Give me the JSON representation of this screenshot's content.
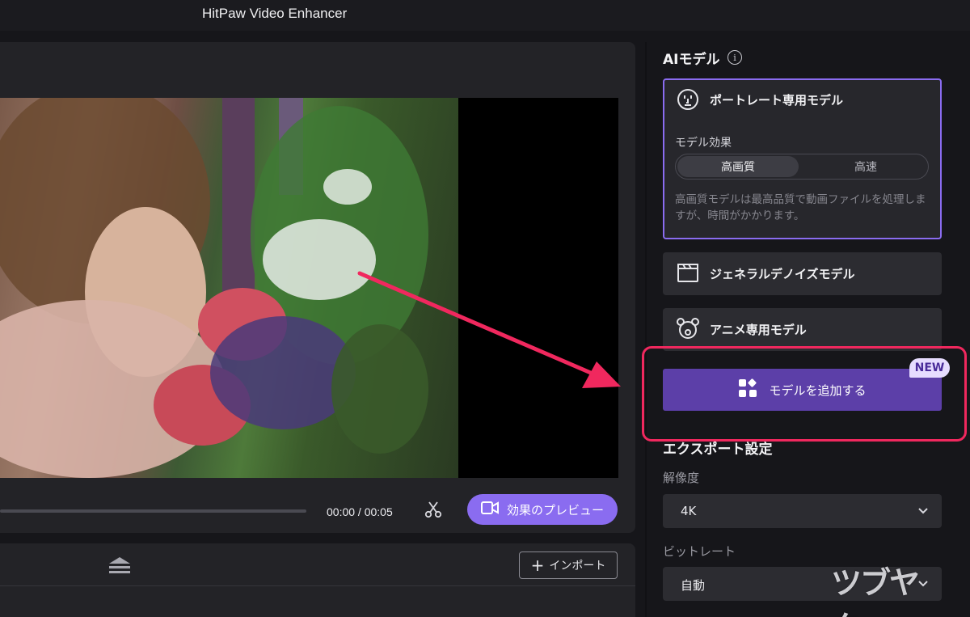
{
  "app": {
    "title": "HitPaw Video Enhancer"
  },
  "player": {
    "time": "00:00 / 00:05",
    "preview_label": "効果のプレビュー",
    "import_label": "インポート"
  },
  "ai_model": {
    "section_title": "AIモデル",
    "info_icon": "info-icon",
    "portrait": {
      "title": "ポートレート専用モデル",
      "effect_label": "モデル効果",
      "options": [
        "高画質",
        "高速"
      ],
      "selected": "高画質",
      "description": "高画質モデルは最高品質で動画ファイルを処理しますが、時間がかかります。"
    },
    "general_title": "ジェネラルデノイズモデル",
    "anime_title": "アニメ専用モデル",
    "add_model_label": "モデルを追加する",
    "new_badge": "NEW"
  },
  "export": {
    "section_title": "エクスポート設定",
    "resolution_label": "解像度",
    "resolution_value": "4K",
    "bitrate_label": "ビットレート",
    "bitrate_value": "自動"
  },
  "watermark": "ツブヤク。",
  "colors": {
    "accent": "#8a6cf0",
    "add_button": "#5c3fa8",
    "highlight": "#f0285e"
  }
}
